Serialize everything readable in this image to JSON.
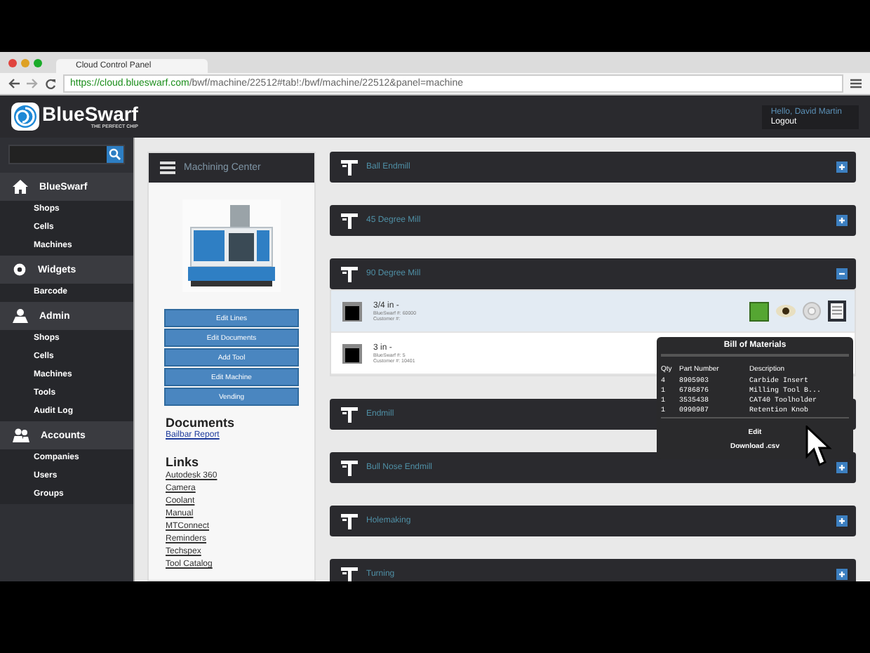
{
  "browser": {
    "tab_title": "Cloud Control Panel",
    "url_host": "https://cloud.blueswarf.com",
    "url_path": "/bwf/machine/22512#tab!:/bwf/machine/22512&panel=machine"
  },
  "header": {
    "logo": "BlueSwarf",
    "tagline": "THE PERFECT CHIP",
    "greeting": "Hello, David Martin",
    "logout": "Logout"
  },
  "sidebar": {
    "groups": [
      {
        "kind": "home",
        "label": "BlueSwarf",
        "items": [
          "Shops",
          "Cells",
          "Machines"
        ]
      },
      {
        "kind": "gear",
        "label": "Widgets",
        "items": [
          "Barcode"
        ]
      },
      {
        "kind": "person",
        "label": "Admin",
        "items": [
          "Shops",
          "Cells",
          "Machines",
          "Tools",
          "Audit Log"
        ]
      },
      {
        "kind": "people",
        "label": "Accounts",
        "items": [
          "Companies",
          "Users",
          "Groups"
        ]
      }
    ]
  },
  "machine_panel": {
    "title": "Machining Center",
    "buttons": [
      "Edit Lines",
      "Edit Documents",
      "Add Tool",
      "Edit Machine",
      "Vending"
    ],
    "documents_heading": "Documents",
    "documents": [
      "Bailbar Report"
    ],
    "links_heading": "Links",
    "links": [
      "Autodesk 360",
      "Camera",
      "Coolant",
      "Manual",
      "MTConnect",
      "Reminders",
      "Techspex",
      "Tool Catalog"
    ]
  },
  "sections": [
    {
      "title": "Ball Endmill",
      "expanded": false
    },
    {
      "title": "45 Degree Mill",
      "expanded": false
    },
    {
      "title": "90 Degree Mill",
      "expanded": true,
      "rows": [
        {
          "name": "3/4 in -",
          "detail_1": "BlueSwarf #: 60000",
          "detail_2": "Customer #:",
          "selected": true
        },
        {
          "name": "3 in -",
          "detail_1": "BlueSwarf #: 5",
          "detail_2": "Customer #: 10401",
          "selected": false
        }
      ]
    },
    {
      "title": "Endmill",
      "expanded": false
    },
    {
      "title": "Bull Nose Endmill",
      "expanded": false
    },
    {
      "title": "Holemaking",
      "expanded": false
    },
    {
      "title": "Turning",
      "expanded": false
    }
  ],
  "bom": {
    "title": "Bill of Materials",
    "columns": [
      "Qty",
      "Part Number",
      "Description"
    ],
    "rows": [
      [
        "4",
        "8905903",
        "Carbide Insert"
      ],
      [
        "1",
        "6786876",
        "Milling Tool B..."
      ],
      [
        "1",
        "3535438",
        "CAT40 Toolholder"
      ],
      [
        "1",
        "0990987",
        "Retention Knob"
      ]
    ],
    "actions": [
      "Edit",
      "Download .csv"
    ]
  }
}
